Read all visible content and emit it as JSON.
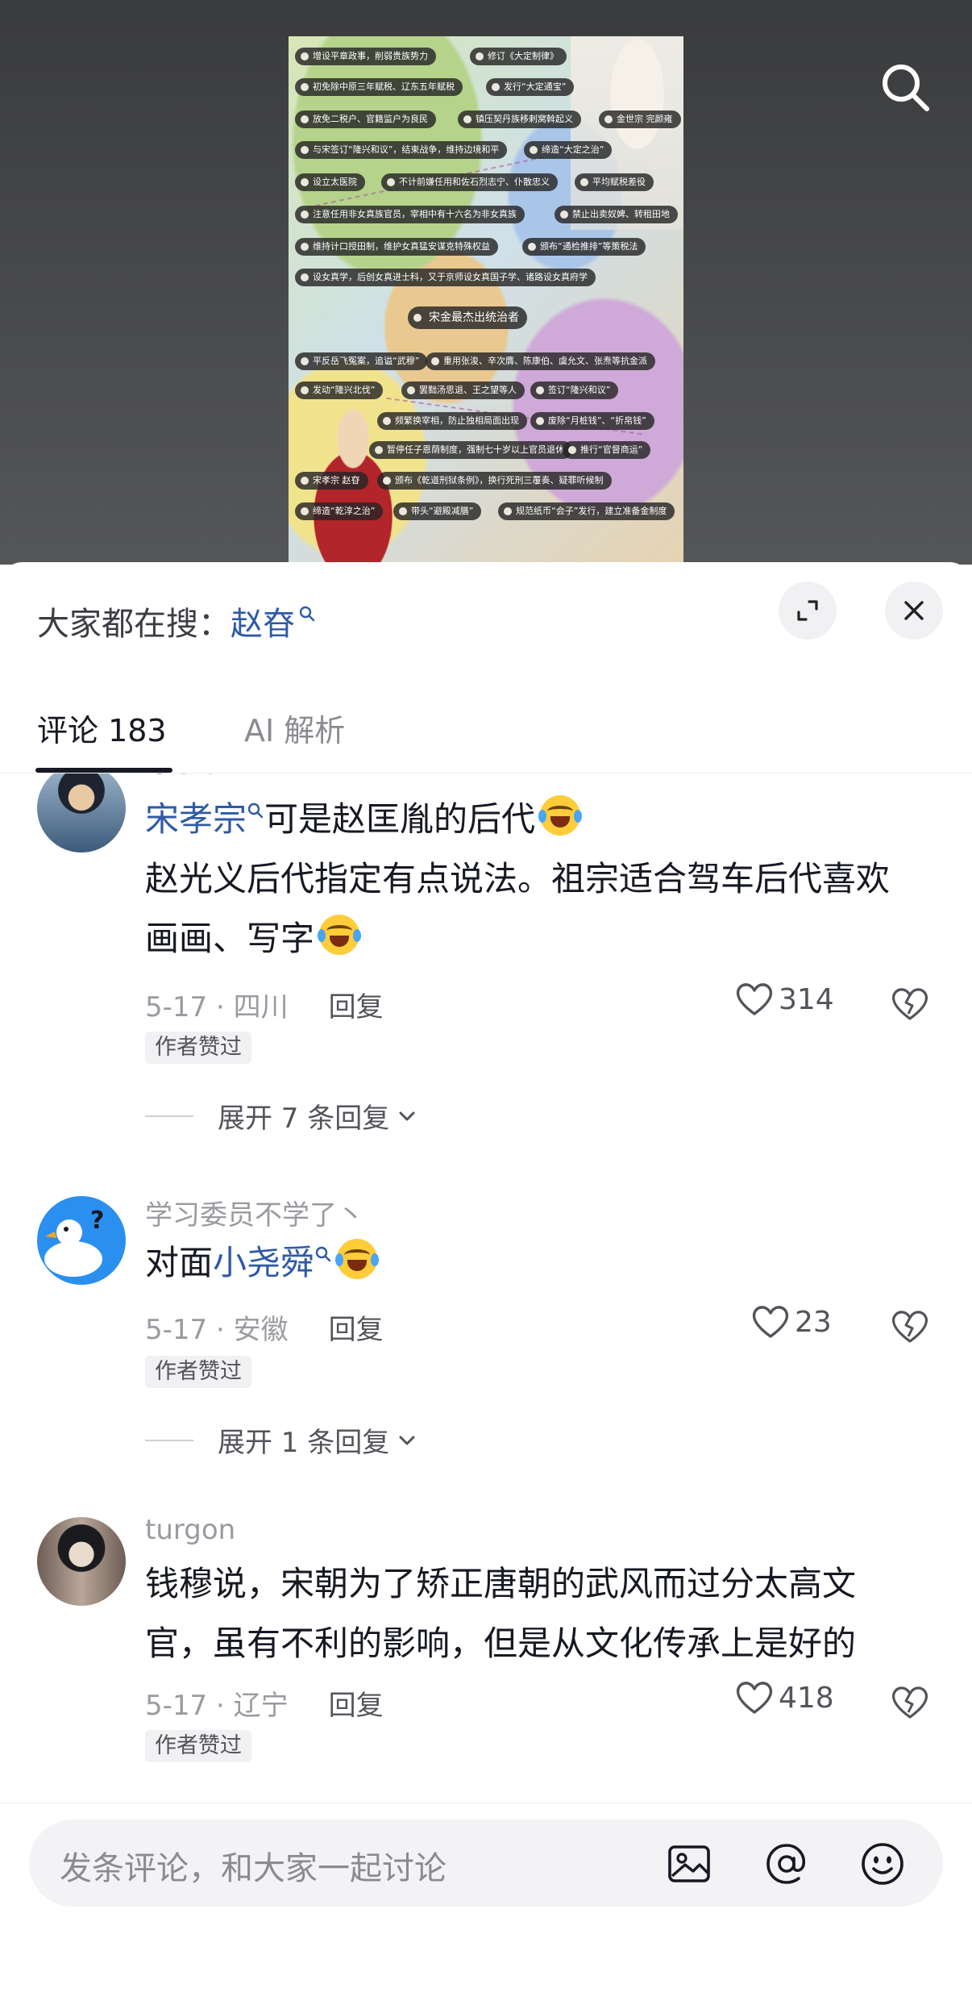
{
  "video": {
    "pills": [
      {
        "text": "增设平章政事，削弱贵族势力"
      },
      {
        "text": "修订《大定制律》"
      },
      {
        "text": "初免除中原三年赋税、辽东五年赋税"
      },
      {
        "text": "发行“大定通宝”"
      },
      {
        "text": "放免二税户、官籍监户为良民"
      },
      {
        "text": "镇压契丹族移剌窝斡起义"
      },
      {
        "text": "金世宗 完颜雍"
      },
      {
        "text": "与宋签订“隆兴和议”，结束战争，维持边境和平"
      },
      {
        "text": "缔造“大定之治”"
      },
      {
        "text": "设立太医院"
      },
      {
        "text": "不计前嫌任用和佐石烈志宁、仆散忠义"
      },
      {
        "text": "平均赋税差役"
      },
      {
        "text": "注意任用非女真族官员，宰相中有十六名为非女真族"
      },
      {
        "text": "禁止出卖奴婢、转租田地"
      },
      {
        "text": "维持计口授田制，维护女真猛安谋克特殊权益"
      },
      {
        "text": "颁布“通检推排”等策税法"
      },
      {
        "text": "设女真学，后创女真进士科，又于京师设女真国子学、诸路设女真府学"
      },
      {
        "text": "宋金最杰出统治者"
      },
      {
        "text": "平反岳飞冤案，追谥“武穆”"
      },
      {
        "text": "重用张浚、辛次膺、陈康伯、虞允文、张焘等抗金派"
      },
      {
        "text": "发动“隆兴北伐”"
      },
      {
        "text": "罢黜汤思退、王之望等人"
      },
      {
        "text": "签订“隆兴和议”"
      },
      {
        "text": "频繁换宰相，防止独相局面出现"
      },
      {
        "text": "废除“月桩钱”、“折帛钱”"
      },
      {
        "text": "暂停任子恩荫制度，强制七十岁以上官员退休"
      },
      {
        "text": "推行“官督商运”"
      },
      {
        "text": "宋孝宗 赵昚"
      },
      {
        "text": "颁布《乾道刑狱条例》，换行死刑三覆奏、疑罪听候制"
      },
      {
        "text": "缔造“乾淳之治”"
      },
      {
        "text": "带头“避殿减膳”"
      },
      {
        "text": "规范纸币“会子”发行，建立准备金制度"
      }
    ]
  },
  "header": {
    "search_prefix": "大家都在搜：",
    "search_term": "赵昚"
  },
  "tabs": {
    "comments_label": "评论 183",
    "ai_label": "AI 解析"
  },
  "comments": [
    {
      "author": "なまう",
      "link_text": "宋孝宗",
      "text_after_link": "可是赵匡胤的后代",
      "line2": "赵光义后代指定有点说法。祖宗适合驾车后代喜欢",
      "line3": "画画、写字",
      "meta": "5-17 · 四川",
      "reply": "回复",
      "likes": "314",
      "badge": "作者赞过",
      "expand": "展开 7 条回复"
    },
    {
      "author": "学习委员不学了丶",
      "text_before_link": "对面",
      "link_text": "小尧舜",
      "meta": "5-17 · 安徽",
      "reply": "回复",
      "likes": "23",
      "badge": "作者赞过",
      "expand": "展开 1 条回复"
    },
    {
      "author": "turgon",
      "line1": "钱穆说，宋朝为了矫正唐朝的武风而过分太高文",
      "line2": "官，虽有不利的影响，但是从文化传承上是好的",
      "meta": "5-17 · 辽宁",
      "reply": "回复",
      "likes": "418",
      "badge": "作者赞过"
    }
  ],
  "input": {
    "placeholder": "发条评论，和大家一起讨论"
  },
  "colors": {
    "link": "#2f5aa5",
    "text": "#161823",
    "muted": "#9a9ba1"
  }
}
